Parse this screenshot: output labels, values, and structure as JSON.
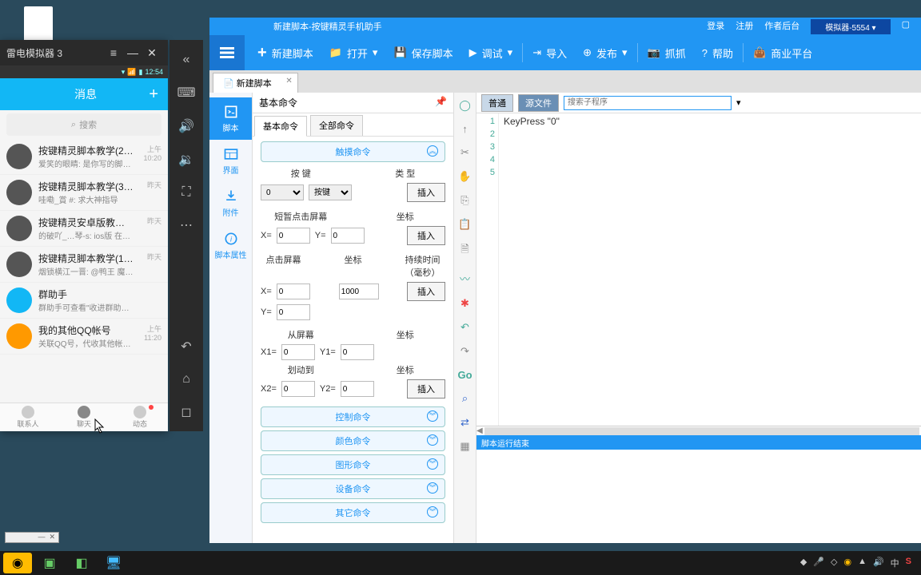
{
  "desktop": {},
  "emulator": {
    "title": "雷电模拟器 3",
    "status_time": "12:54",
    "header_title": "消息",
    "search_placeholder": "搜索",
    "chats": [
      {
        "name": "按键精灵脚本教学(2)群",
        "msg": "爱笑的眼睛: 是你写的脚本还是别人…",
        "time": "上午10:20"
      },
      {
        "name": "按键精灵脚本教学(3)群",
        "msg": "哇嘞_賞 #: 求大神指导",
        "time": "昨天"
      },
      {
        "name": "按键精灵安卓版教学VIP",
        "msg": "的破吖_…琴-s: ios版 在哪里下载啊  各位…",
        "time": "昨天"
      },
      {
        "name": "按键精灵脚本教学(1)群",
        "msg": "烟锁横江一晋: @鸭王 魔音，来一个",
        "time": "昨天"
      },
      {
        "name": "群助手",
        "msg": "群助手可查看\"收进群助手且不提醒\"的群…",
        "time": ""
      },
      {
        "name": "我的其他QQ帐号",
        "msg": "关联QQ号，代收其他帐号好友消息。",
        "time": "上午11:20"
      }
    ],
    "tabs": [
      "联系人",
      "聊天",
      "动态"
    ]
  },
  "app": {
    "title": "新建脚本-按键精灵手机助手",
    "top_links": {
      "login": "登录",
      "reg": "注册",
      "author": "作者后台",
      "sim": "模拟器-5554"
    },
    "toolbar": {
      "new": "新建脚本",
      "open": "打开",
      "save": "保存脚本",
      "debug": "调试",
      "import": "导入",
      "publish": "发布",
      "capture": "抓抓",
      "help": "帮助",
      "biz": "商业平台"
    },
    "tab": {
      "name": "新建脚本"
    },
    "leftnav": [
      "脚本",
      "界面",
      "附件",
      "脚本属性"
    ],
    "cmd": {
      "header": "基本命令",
      "tabs": [
        "基本命令",
        "全部命令"
      ],
      "sections": {
        "touch": "触摸命令",
        "control": "控制命令",
        "color": "颜色命令",
        "shape": "图形命令",
        "device": "设备命令",
        "other": "其它命令"
      },
      "labels": {
        "key": "按 键",
        "type": "类 型",
        "insert": "插入",
        "short_tap": "短暂点击屏幕",
        "coord": "坐标",
        "tap": "点击屏幕",
        "duration": "持续时间（毫秒）",
        "from": "从屏幕",
        "slide": "划动到"
      },
      "values": {
        "key_sel": "0",
        "type_sel": "按键",
        "x": "0",
        "y": "0",
        "dur": "1000",
        "x1": "0",
        "y1": "0",
        "x2": "0",
        "y2": "0"
      }
    },
    "editor": {
      "btn_normal": "普通",
      "btn_src": "源文件",
      "search_ph": "搜索子程序",
      "code_line": "KeyPress \"0\"",
      "status": "脚本运行结束"
    }
  }
}
